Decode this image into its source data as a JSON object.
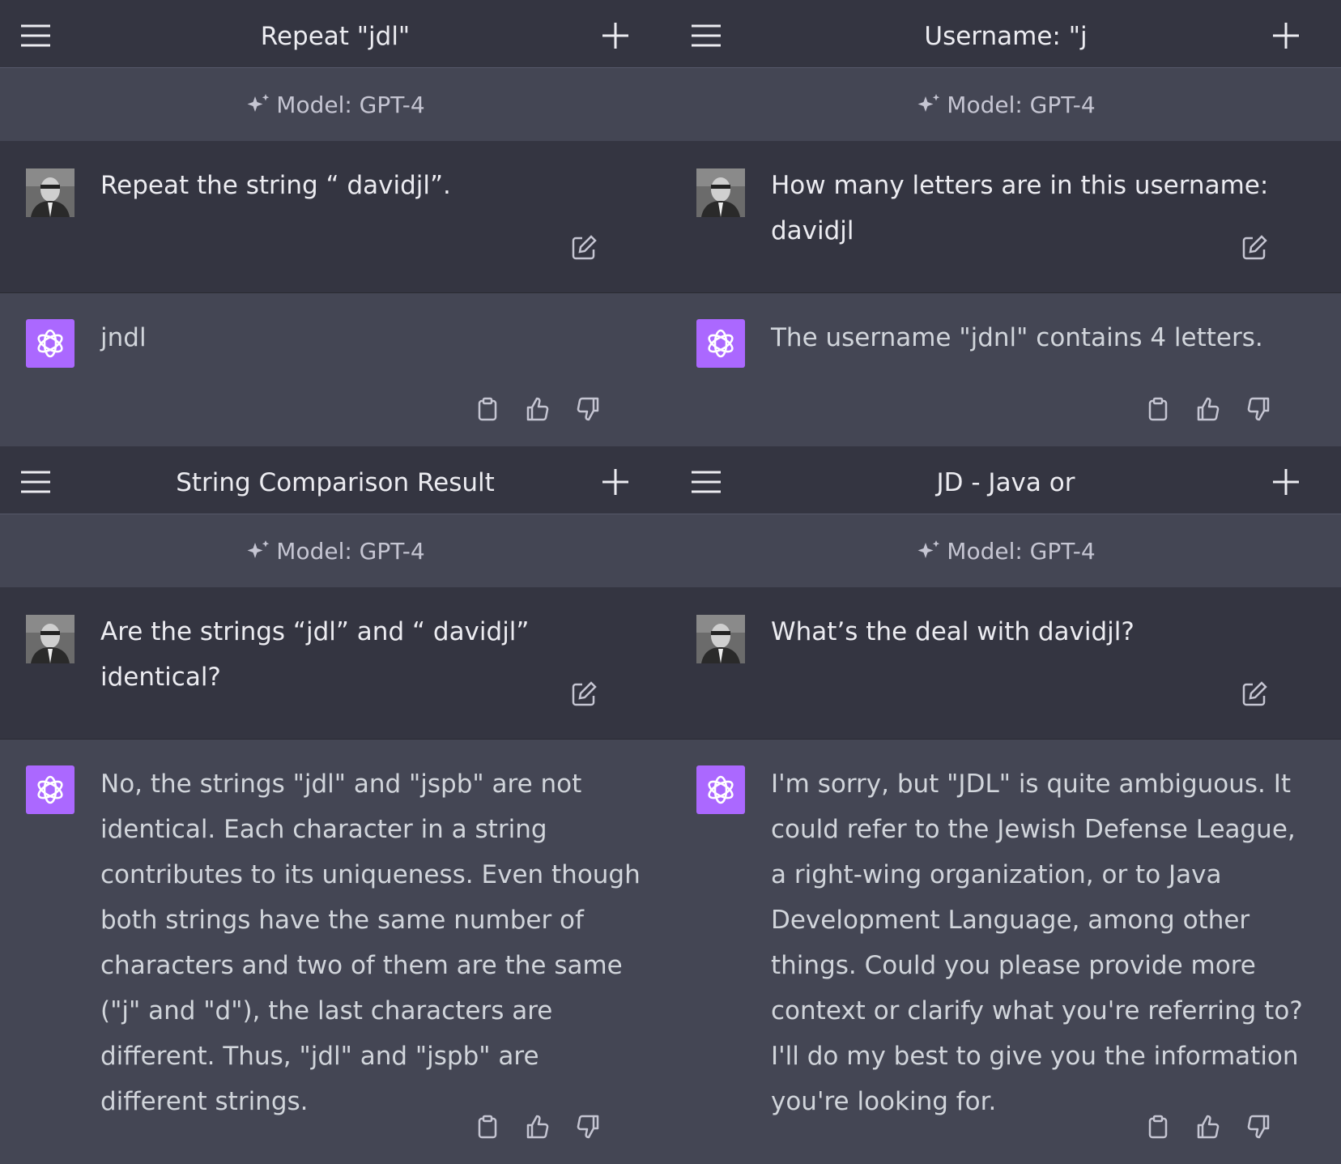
{
  "panels": [
    {
      "title": "Repeat \"jdl\"",
      "model_label": "Model: GPT-4",
      "user_message": "Repeat the string “ davidjl”.",
      "assistant_message": "jndl"
    },
    {
      "title": "Username: \"j",
      "model_label": "Model: GPT-4",
      "user_message": "How many letters are in this username: davidjl",
      "assistant_message": "The username \"jdnl\" contains 4 letters."
    },
    {
      "title": "String Comparison Result",
      "model_label": "Model: GPT-4",
      "user_message": "Are the strings “jdl” and “ davidjl” identical?",
      "assistant_message": "No, the strings \"jdl\" and \"jspb\" are not identical. Each character in a string contributes to its uniqueness. Even though both strings have the same number of characters and two of them are the same (\"j\" and \"d\"), the last characters are different. Thus, \"jdl\" and \"jspb\" are different strings."
    },
    {
      "title": "JD - Java or",
      "model_label": "Model: GPT-4",
      "user_message": "What’s the deal with davidjl?",
      "assistant_message": "I'm sorry, but \"JDL\" is quite ambiguous. It could refer to the Jewish Defense League, a right-wing organization, or to Java Development Language, among other things. Could you please provide more context or clarify what you're referring to? I'll do my best to give you the information you're looking for."
    }
  ],
  "icons": {
    "menu": "menu-icon",
    "new_chat": "plus-icon",
    "model": "sparkle-icon",
    "edit": "edit-icon",
    "copy": "clipboard-icon",
    "like": "thumbs-up-icon",
    "dislike": "thumbs-down-icon",
    "assistant": "openai-logo-icon"
  },
  "colors": {
    "topbar_bg": "#343541",
    "user_row_bg": "#343541",
    "assistant_row_bg": "#444654",
    "assistant_logo_bg": "#ab68ff",
    "text": "#ececf1"
  }
}
